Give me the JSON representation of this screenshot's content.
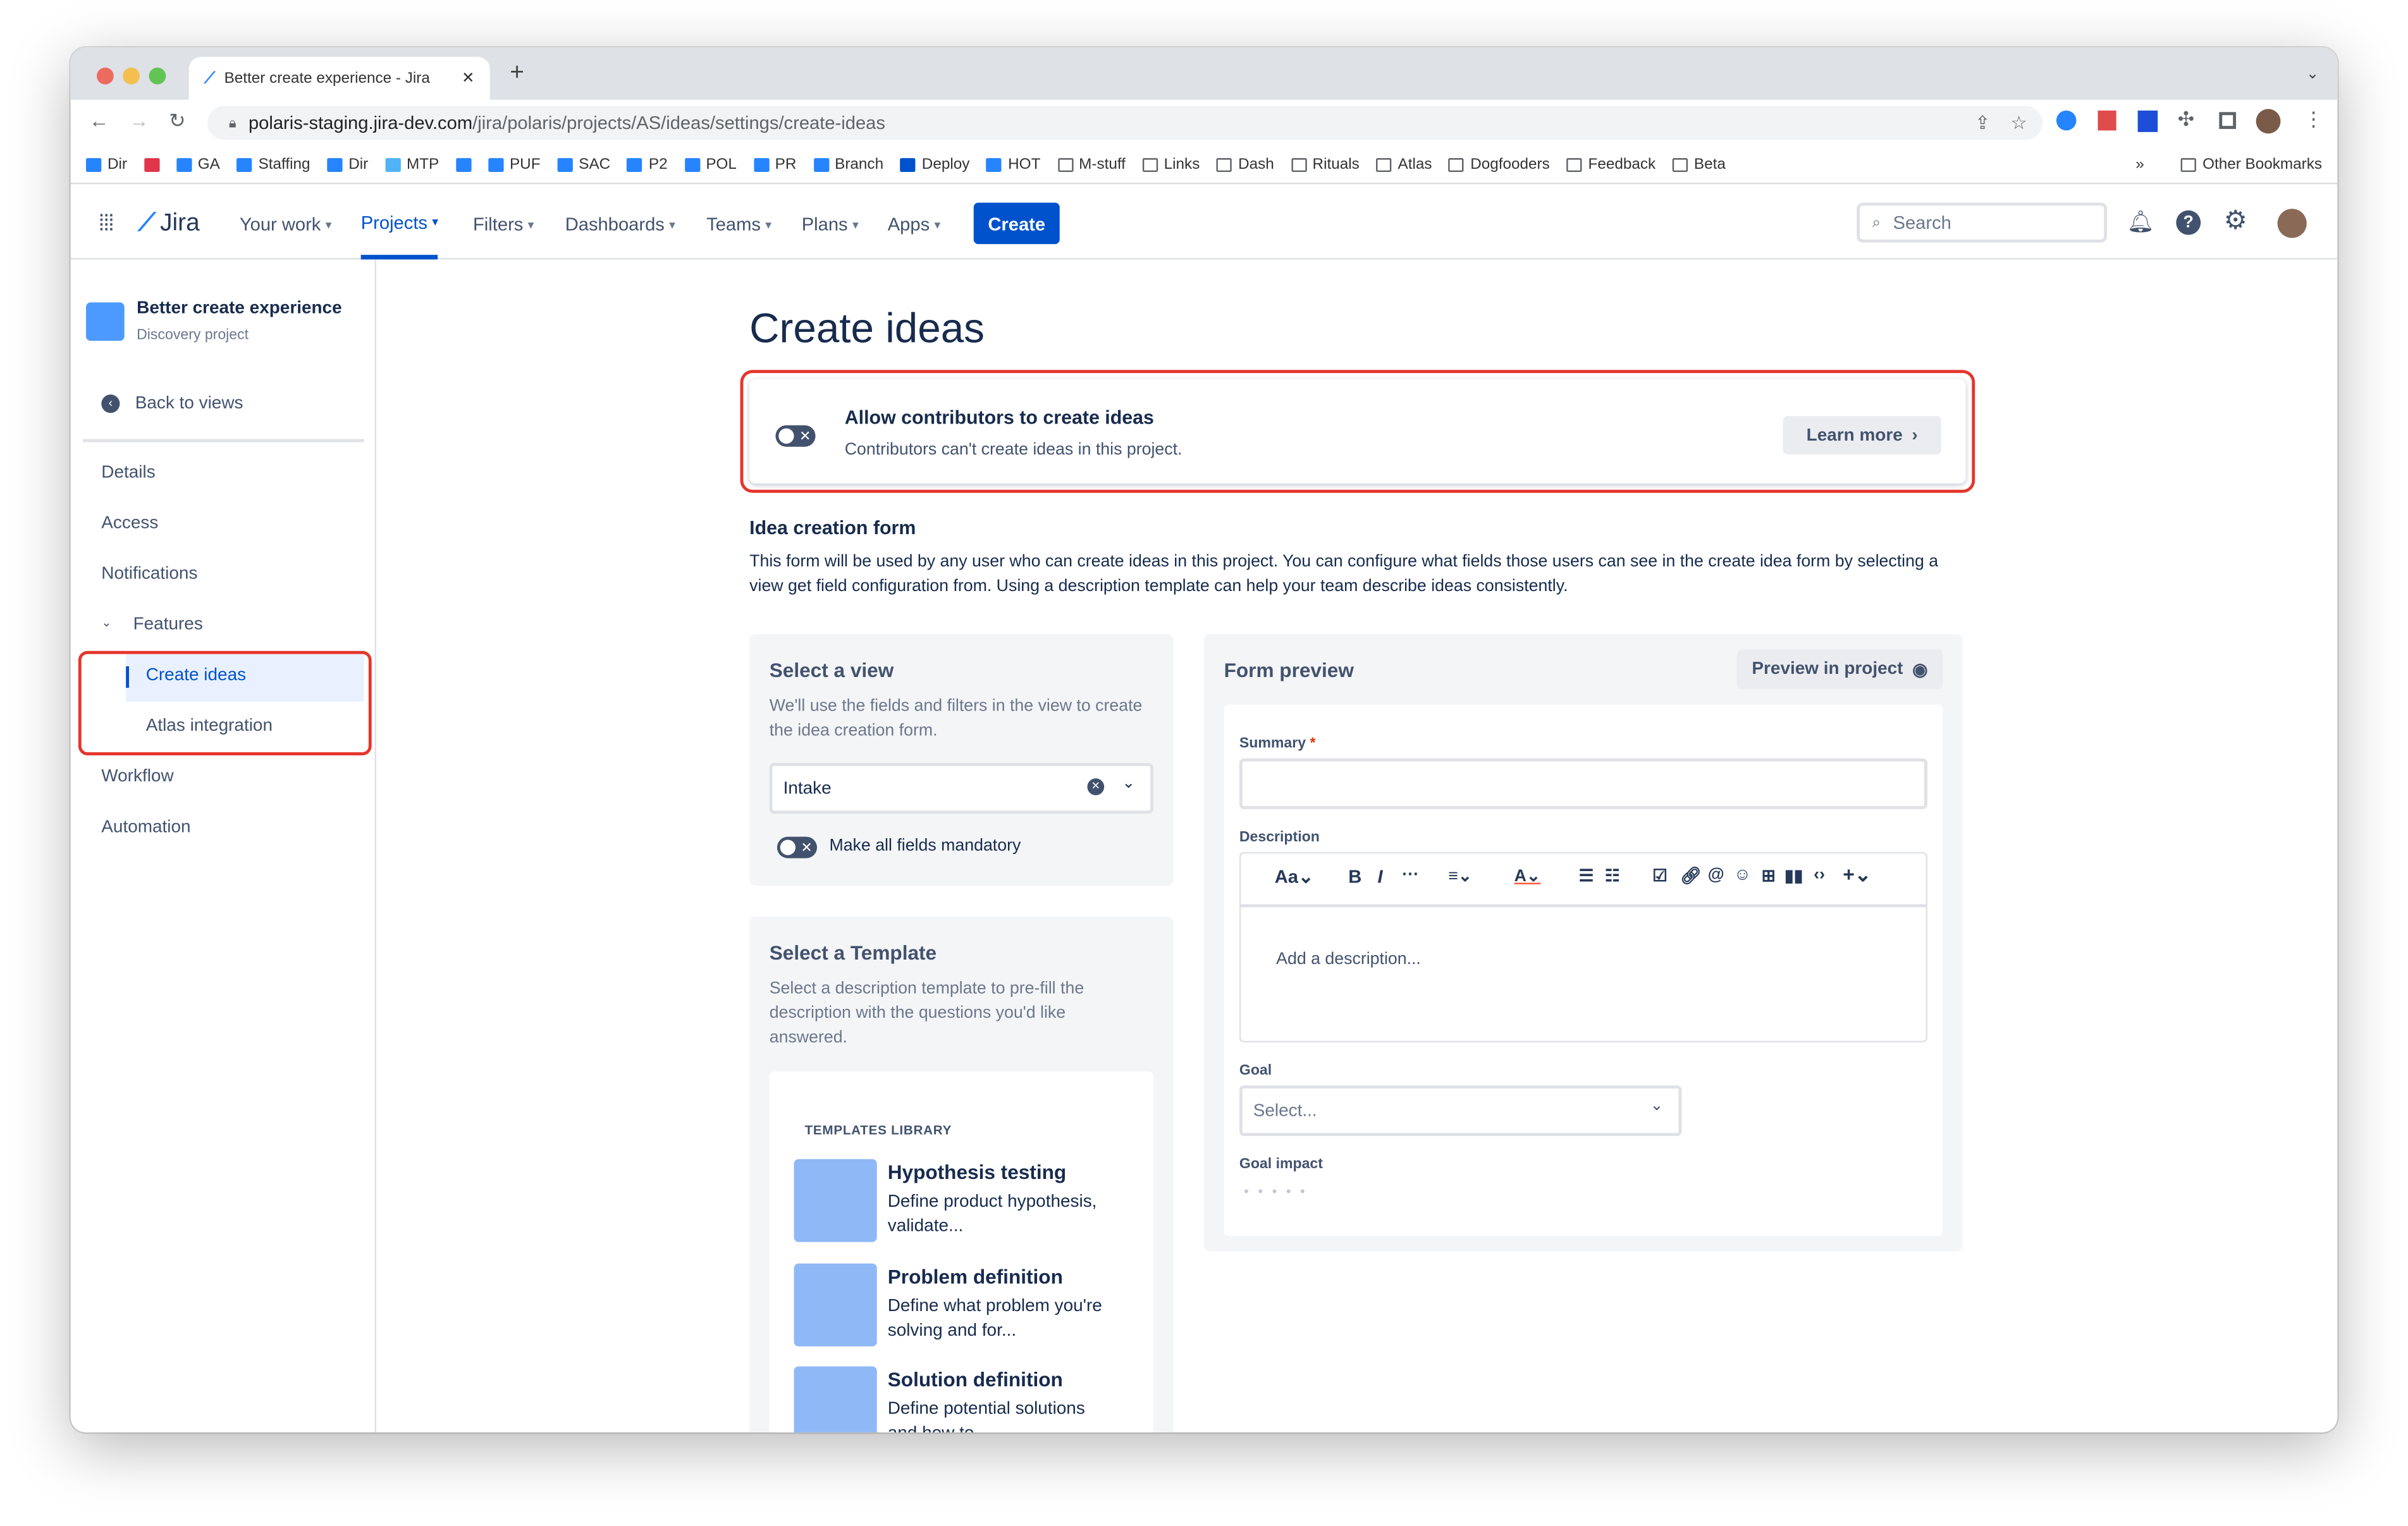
{
  "browser": {
    "tab_title": "Better create experience - Jira",
    "url_host": "polaris-staging.jira-dev.com",
    "url_path": "/jira/polaris/projects/AS/ideas/settings/create-ideas",
    "bookmarks": [
      "Dir",
      "",
      "GA",
      "Staffing",
      "Dir",
      "MTP",
      "",
      "PUF",
      "SAC",
      "P2",
      "POL",
      "PR",
      "Branch",
      "Deploy",
      "HOT",
      "M-stuff",
      "Links",
      "Dash",
      "Rituals",
      "Atlas",
      "Dogfooders",
      "Feedback",
      "Beta"
    ],
    "other_bookmarks": "Other Bookmarks"
  },
  "nav": {
    "logo": "Jira",
    "items": [
      "Your work",
      "Projects",
      "Filters",
      "Dashboards",
      "Teams",
      "Plans",
      "Apps"
    ],
    "create": "Create",
    "search_placeholder": "Search"
  },
  "sidebar": {
    "project_name": "Better create experience",
    "project_type": "Discovery project",
    "back": "Back to views",
    "items": [
      "Details",
      "Access",
      "Notifications",
      "Features",
      "Create ideas",
      "Atlas integration",
      "Workflow",
      "Automation"
    ]
  },
  "main": {
    "title": "Create ideas",
    "allow": {
      "title": "Allow contributors to create ideas",
      "desc": "Contributors can't create ideas in this project.",
      "learn_more": "Learn more"
    },
    "form_section": {
      "title": "Idea creation form",
      "desc": "This form will be used by any user who can create ideas in this project. You can configure what fields those users can see in the create idea form by selecting a view get field configuration from. Using a description template can help your team describe ideas consistently."
    },
    "select_view": {
      "title": "Select a view",
      "desc": "We'll use the fields and filters in the view to create the idea creation form.",
      "value": "Intake",
      "mandatory": "Make all fields mandatory"
    },
    "template": {
      "title": "Select a Template",
      "desc": "Select a description template to pre-fill the description with the questions you'd like answered.",
      "library": "TEMPLATES LIBRARY",
      "items": [
        {
          "title": "Hypothesis testing",
          "desc": "Define product hypothesis, validate..."
        },
        {
          "title": "Problem definition",
          "desc": "Define what problem you're solving and for..."
        },
        {
          "title": "Solution definition",
          "desc": "Define potential solutions and how to..."
        }
      ]
    },
    "preview": {
      "title": "Form preview",
      "button": "Preview in project",
      "summary": "Summary",
      "required": "*",
      "description": "Description",
      "toolbar_text": "Aa",
      "desc_placeholder": "Add a description...",
      "goal": "Goal",
      "goal_placeholder": "Select...",
      "goal_impact": "Goal impact"
    }
  }
}
